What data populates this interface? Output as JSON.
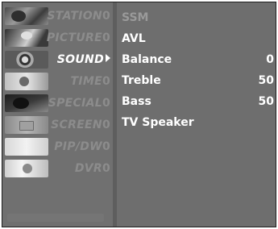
{
  "left_menu": {
    "items": [
      {
        "label": "STATION",
        "suffix": "0",
        "state": "dim",
        "icon": "station-icon"
      },
      {
        "label": "PICTURE",
        "suffix": "0",
        "state": "dim",
        "icon": "picture-icon"
      },
      {
        "label": "SOUND",
        "suffix": "",
        "state": "active",
        "icon": "sound-icon"
      },
      {
        "label": "TIME",
        "suffix": "0",
        "state": "dim",
        "icon": "time-icon"
      },
      {
        "label": "SPECIAL",
        "suffix": "0",
        "state": "dim",
        "icon": "special-icon"
      },
      {
        "label": "SCREEN",
        "suffix": "0",
        "state": "dim",
        "icon": "screen-icon"
      },
      {
        "label": "PIP/DW",
        "suffix": "0",
        "state": "dim",
        "icon": "pip-icon"
      },
      {
        "label": "DVR",
        "suffix": "0",
        "state": "dim",
        "icon": "dvr-icon"
      }
    ]
  },
  "right_menu": {
    "items": [
      {
        "label": "SSM",
        "value": "",
        "state": "dim"
      },
      {
        "label": "AVL",
        "value": "",
        "state": "normal"
      },
      {
        "label": "Balance",
        "value": "0",
        "state": "normal"
      },
      {
        "label": "Treble",
        "value": "50",
        "state": "normal"
      },
      {
        "label": "Bass",
        "value": "50",
        "state": "normal"
      },
      {
        "label": "TV Speaker",
        "value": "",
        "state": "normal"
      }
    ]
  }
}
